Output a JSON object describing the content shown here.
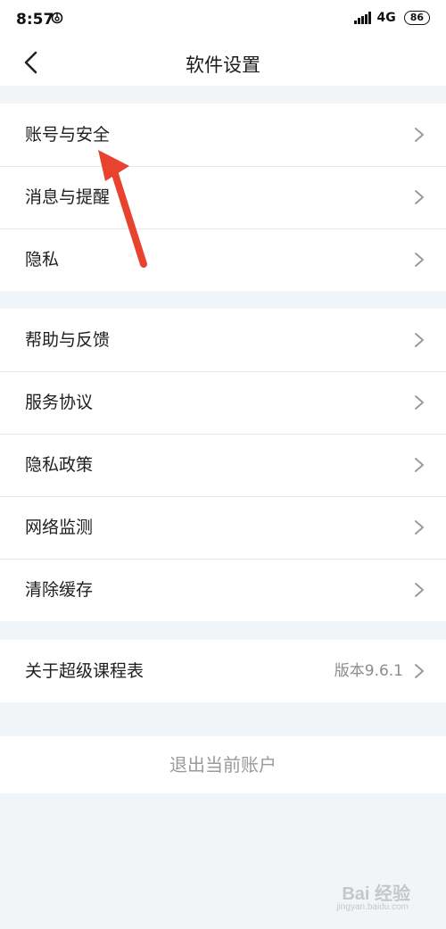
{
  "status_bar": {
    "time": "8:57",
    "network": "4G",
    "battery": "86"
  },
  "header": {
    "title": "软件设置"
  },
  "group_account": [
    {
      "label": "账号与安全"
    },
    {
      "label": "消息与提醒"
    },
    {
      "label": "隐私"
    }
  ],
  "group_support": [
    {
      "label": "帮助与反馈"
    },
    {
      "label": "服务协议"
    },
    {
      "label": "隐私政策"
    },
    {
      "label": "网络监测"
    },
    {
      "label": "清除缓存"
    }
  ],
  "group_about": {
    "label": "关于超级课程表",
    "value": "版本9.6.1"
  },
  "logout": {
    "label": "退出当前账户"
  },
  "watermark": {
    "text": "Bai 经验",
    "sub": "jingyan.baidu.com"
  },
  "colors": {
    "background": "#f1f5f8",
    "annotation_arrow": "#e8432f",
    "chevron": "#9b9b9b"
  }
}
